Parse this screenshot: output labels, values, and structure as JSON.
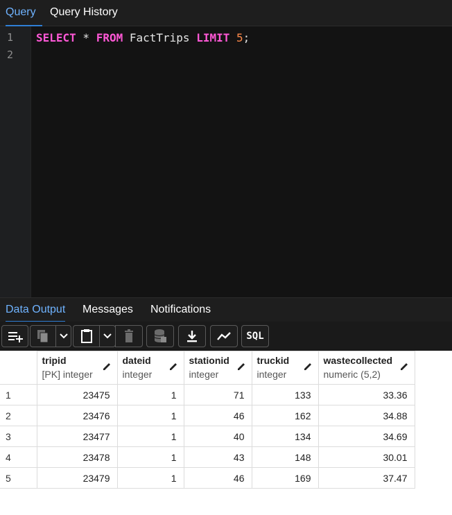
{
  "top_tabs": {
    "query": "Query",
    "history": "Query History"
  },
  "editor": {
    "line_numbers": [
      "1",
      "2"
    ],
    "sql": {
      "kw1": "SELECT",
      "star": " * ",
      "kw2": "FROM",
      "table": " FactTrips ",
      "kw3": "LIMIT",
      "space": " ",
      "limit": "5",
      "semi": ";"
    }
  },
  "bottom_tabs": {
    "data_output": "Data Output",
    "messages": "Messages",
    "notifications": "Notifications"
  },
  "toolbar": {
    "sql_label": "SQL"
  },
  "colors": {
    "active_tab": "#6fb3ff",
    "keyword": "#ff58d6",
    "number": "#ff8a4a",
    "editor_bg": "#131313"
  },
  "grid": {
    "columns": [
      {
        "name": "tripid",
        "type": "[PK] integer"
      },
      {
        "name": "dateid",
        "type": "integer"
      },
      {
        "name": "stationid",
        "type": "integer"
      },
      {
        "name": "truckid",
        "type": "integer"
      },
      {
        "name": "wastecollected",
        "type": "numeric (5,2)"
      }
    ],
    "rows": [
      {
        "n": "1",
        "cells": [
          "23475",
          "1",
          "71",
          "133",
          "33.36"
        ]
      },
      {
        "n": "2",
        "cells": [
          "23476",
          "1",
          "46",
          "162",
          "34.88"
        ]
      },
      {
        "n": "3",
        "cells": [
          "23477",
          "1",
          "40",
          "134",
          "34.69"
        ]
      },
      {
        "n": "4",
        "cells": [
          "23478",
          "1",
          "43",
          "148",
          "30.01"
        ]
      },
      {
        "n": "5",
        "cells": [
          "23479",
          "1",
          "46",
          "169",
          "37.47"
        ]
      }
    ]
  }
}
